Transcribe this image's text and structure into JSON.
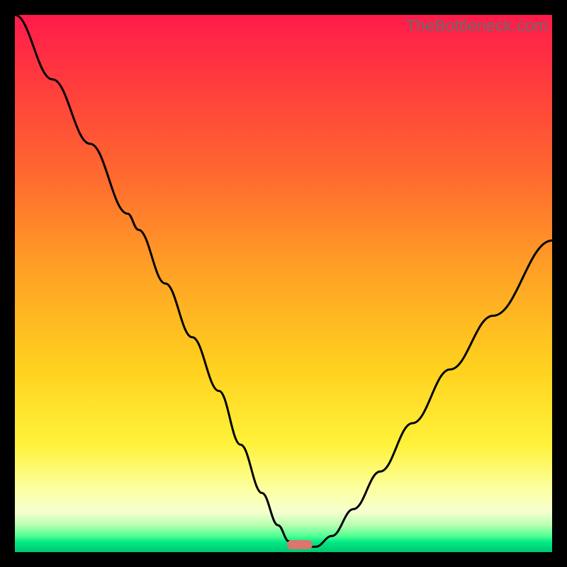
{
  "watermark": "TheBottleneck.com",
  "colors": {
    "frame": "#000000",
    "curve_stroke": "#000000",
    "marker_fill": "#d9766f",
    "gradient_stops": [
      "#ff1b4b",
      "#ff3a3e",
      "#ff6a2f",
      "#ffa225",
      "#ffd21f",
      "#fff23a",
      "#fcff9e",
      "#f6ffd0",
      "#b6ffb0",
      "#4fff93",
      "#00e884",
      "#00c76f"
    ]
  },
  "chart_data": {
    "type": "line",
    "title": "",
    "xlabel": "",
    "ylabel": "",
    "xlim": [
      0,
      100
    ],
    "ylim": [
      0,
      100
    ],
    "marker_x": 53,
    "series": [
      {
        "name": "bottleneck-curve",
        "x": [
          0,
          7,
          14,
          21,
          23,
          28,
          33,
          38,
          42,
          46,
          49,
          51,
          53,
          56,
          59,
          63,
          68,
          74,
          81,
          89,
          100
        ],
        "values": [
          100,
          88,
          76,
          63,
          60,
          50,
          40,
          30,
          20,
          11,
          5,
          2,
          1,
          1,
          3,
          8,
          15,
          24,
          34,
          44,
          58
        ]
      }
    ]
  }
}
